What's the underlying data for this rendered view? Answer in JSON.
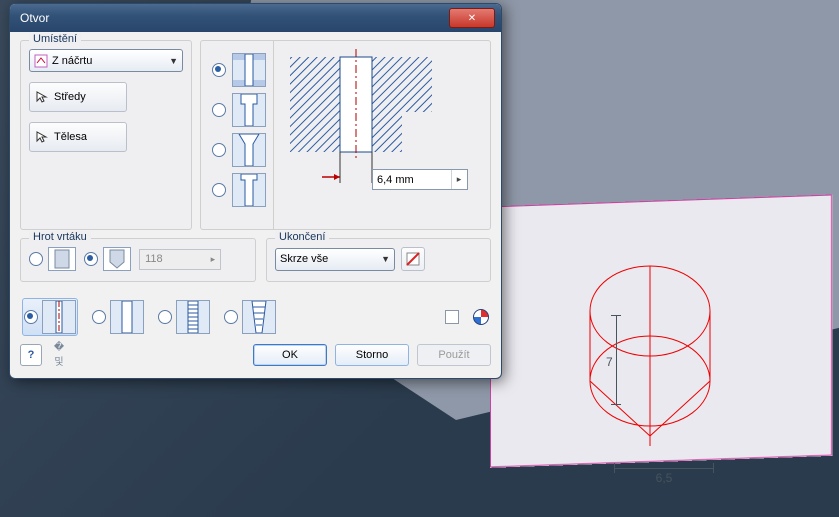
{
  "dialog": {
    "title": "Otvor",
    "placement": {
      "caption": "Umístění",
      "combo": {
        "label": "Z náčrtu",
        "icon": "sketch-icon"
      },
      "centers_btn": "Středy",
      "solids_btn": "Tělesa"
    },
    "hole_types": {
      "selected_index": 0,
      "names": [
        "simple-hole-icon",
        "counterbore-hole-icon",
        "countersink-hole-icon",
        "spotface-hole-icon"
      ]
    },
    "diameter_field": "6,4 mm",
    "drill_point": {
      "caption": "Hrot vrtáku",
      "selected_index": 1,
      "angle_value": "118",
      "names": [
        "flat-tip-icon",
        "angled-tip-icon"
      ]
    },
    "termination": {
      "caption": "Ukončení",
      "combo_label": "Skrze vše",
      "flip_btn_name": "flip-direction-icon"
    },
    "thread_row": {
      "selected_index": 0,
      "names": [
        "none-thread-icon",
        "clearance-thread-icon",
        "tapped-thread-icon",
        "taper-thread-icon"
      ]
    },
    "preserve_checkbox_name": "preserve-checkbox",
    "color_override_name": "color-override-icon",
    "buttons": {
      "ok": "OK",
      "cancel": "Storno",
      "apply": "Použít"
    }
  },
  "viewport": {
    "dim_radius": "6,5",
    "dim_height": "7"
  }
}
